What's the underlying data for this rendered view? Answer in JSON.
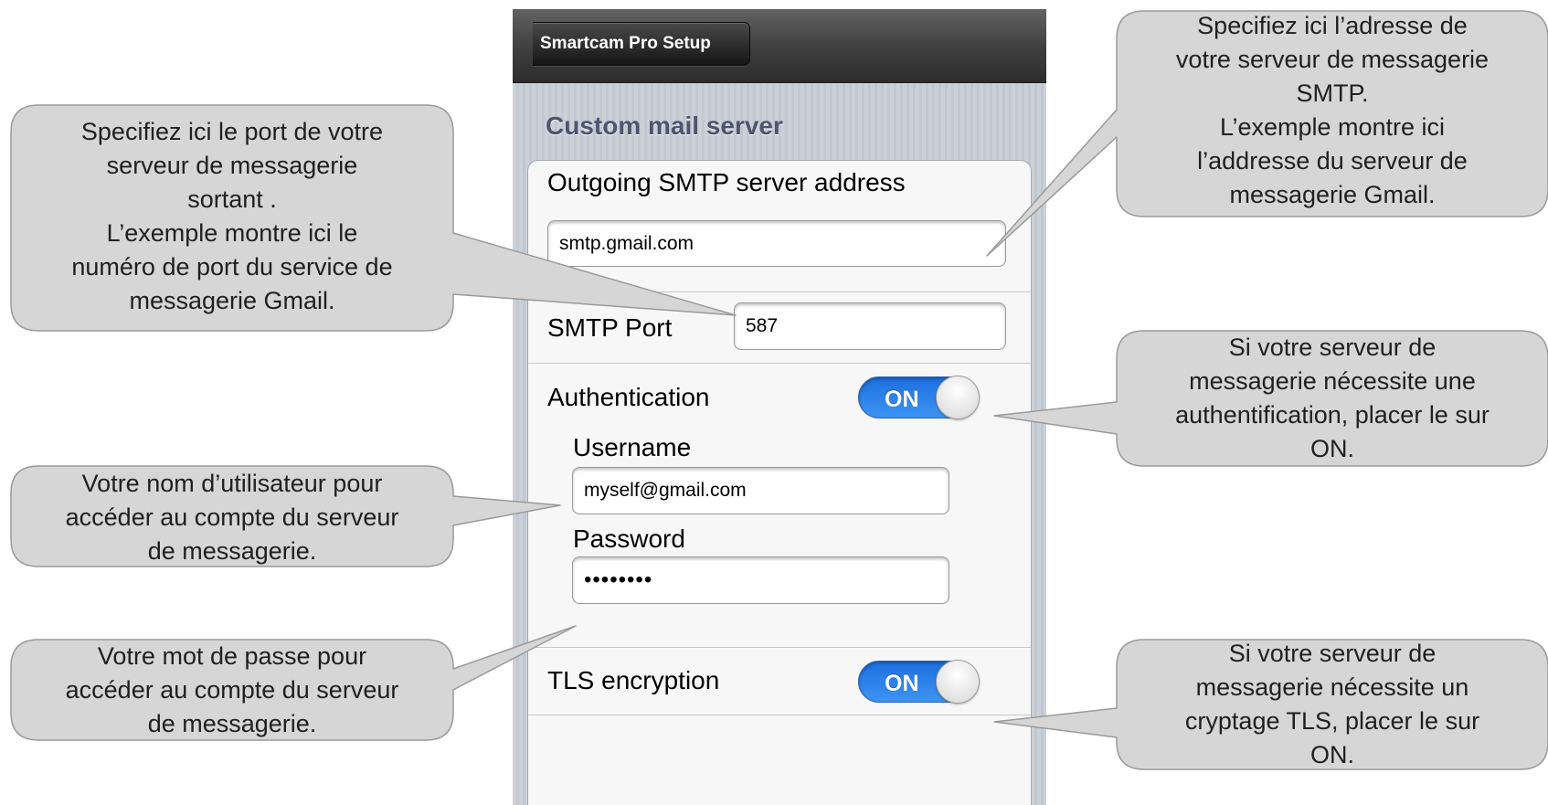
{
  "nav": {
    "back_label": "Smartcam Pro Setup"
  },
  "section": {
    "title": "Custom mail server"
  },
  "form": {
    "smtp_address_label": "Outgoing SMTP server address",
    "smtp_address_value": "smtp.gmail.com",
    "smtp_port_label": "SMTP Port",
    "smtp_port_value": "587",
    "authentication_label": "Authentication",
    "authentication_state": "ON",
    "username_label": "Username",
    "username_value": "myself@gmail.com",
    "password_label": "Password",
    "password_value": "••••••••",
    "tls_label": "TLS encryption",
    "tls_state": "ON"
  },
  "callouts": {
    "port": "Specifiez ici le port de votre\nserveur de messagerie\nsortant .\nL’exemple montre ici le\nnuméro de port du service de\nmessagerie Gmail.",
    "address": "Specifiez ici l’adresse de\nvotre serveur de messagerie\nSMTP.\nL’exemple montre ici\nl’addresse du serveur de\nmessagerie Gmail.",
    "authentication": "Si votre serveur de\nmessagerie nécessite une\nauthentification, placer le sur\nON.",
    "username": "Votre nom d’utilisateur pour\naccéder au compte du serveur\nde messagerie.",
    "password": "Votre mot de passe pour\naccéder au compte du serveur\nde messagerie.",
    "tls": "Si votre serveur de\nmessagerie nécessite un\ncryptage TLS, placer le sur\nON."
  },
  "colors": {
    "callout_fill": "#d6d6d6",
    "callout_stroke": "#9a9a9a",
    "toggle_on": "#2f84ee",
    "navbar": "#3e3e3e"
  }
}
